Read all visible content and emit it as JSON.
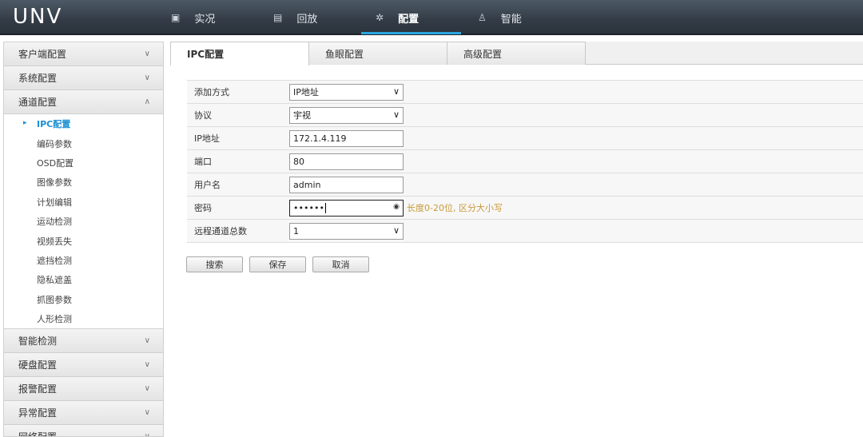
{
  "brand": {
    "logo_text": "UNV"
  },
  "nav": [
    {
      "label": "实况",
      "icon": "monitor-icon",
      "glyph": "▣"
    },
    {
      "label": "回放",
      "icon": "playback-icon",
      "glyph": "▤"
    },
    {
      "label": "配置",
      "icon": "gear-icon",
      "glyph": "✲"
    },
    {
      "label": "智能",
      "icon": "person-icon",
      "glyph": "♙"
    }
  ],
  "sidebar": {
    "top_sections": [
      "客户端配置",
      "系统配置",
      "通道配置"
    ],
    "channel_items": [
      "IPC配置",
      "编码参数",
      "OSD配置",
      "图像参数",
      "计划编辑",
      "运动检测",
      "视频丢失",
      "遮挡检测",
      "隐私遮盖",
      "抓图参数",
      "人形检测"
    ],
    "bottom_sections": [
      "智能检测",
      "硬盘配置",
      "报警配置",
      "异常配置",
      "网络配置"
    ]
  },
  "tabs": [
    "IPC配置",
    "鱼眼配置",
    "高级配置"
  ],
  "form": {
    "add_mode": {
      "label": "添加方式",
      "value": "IP地址"
    },
    "protocol": {
      "label": "协议",
      "value": "宇视"
    },
    "ip": {
      "label": "IP地址",
      "value": "172.1.4.119"
    },
    "port": {
      "label": "端口",
      "value": "80"
    },
    "username": {
      "label": "用户名",
      "value": "admin"
    },
    "password": {
      "label": "密码",
      "value": "••••••",
      "hint": "长度0-20位, 区分大小写"
    },
    "remote_channels": {
      "label": "远程通道总数",
      "value": "1"
    }
  },
  "buttons": {
    "search": "搜索",
    "save": "保存",
    "cancel": "取消"
  },
  "colors": {
    "accent": "#2aa6df",
    "topbar": "#333c46",
    "hint": "#c99a3a"
  }
}
